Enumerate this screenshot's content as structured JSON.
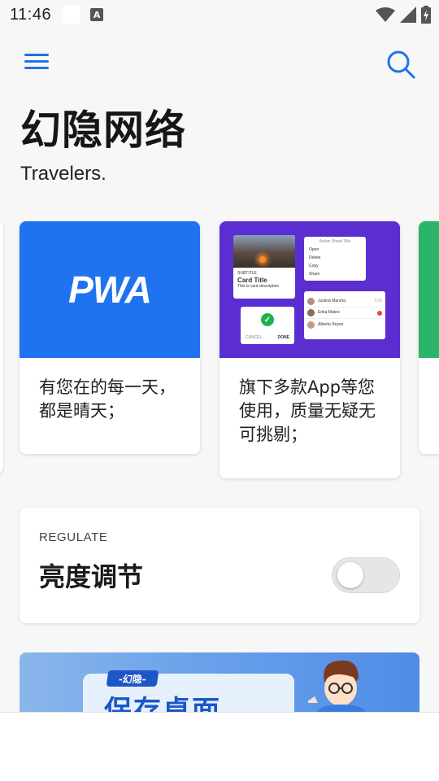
{
  "status_bar": {
    "time": "11:46",
    "notification_icon": "A"
  },
  "header": {
    "title": "幻隐网络",
    "subtitle": "Travelers."
  },
  "carousel": {
    "cards": [
      {
        "logo": "PWA",
        "text": "有您在的每一天，都是晴天；"
      },
      {
        "text": "旗下多款App等您使用，质量无疑无可挑剔；",
        "mini": {
          "photo_card": {
            "overline": "SUBTITLE",
            "title": "Card Title",
            "desc": "This is card description"
          },
          "menu": {
            "title": "Action Sheet Title",
            "items": [
              "Open",
              "Delete",
              "Copy",
              "Share"
            ]
          },
          "contacts": [
            {
              "name": "Justina Marsha",
              "meta": "12/8"
            },
            {
              "name": "Erika Mateo",
              "meta": ""
            },
            {
              "name": "Alberto Reyes",
              "meta": ""
            }
          ],
          "dialog": {
            "cancel": "CANCEL",
            "done": "DONE"
          }
        }
      }
    ]
  },
  "regulate": {
    "overline": "REGULATE",
    "title": "亮度调节",
    "switch_on": false
  },
  "banner": {
    "tag": "-幻隐-",
    "headline": "保存桌面"
  },
  "colors": {
    "accent": "#1f73e8",
    "pwa_blue": "#1f73f0",
    "purple": "#5b2ed1",
    "green": "#2bb56a"
  }
}
